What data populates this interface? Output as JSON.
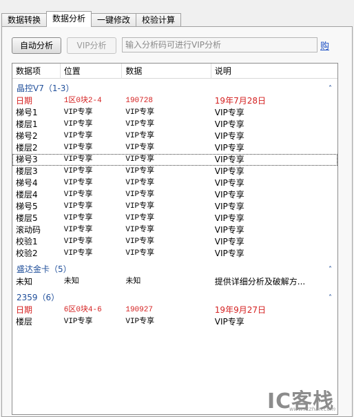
{
  "tabs": [
    "数据转换",
    "数据分析",
    "一键修改",
    "校验计算"
  ],
  "active_tab": 1,
  "toolbar": {
    "auto_analyze_label": "自动分析",
    "vip_analyze_label": "VIP分析",
    "code_placeholder": "输入分析码可进行VIP分析",
    "buy_label": "购"
  },
  "columns": [
    "数据项",
    "位置",
    "数据",
    "说明"
  ],
  "groups": [
    {
      "title": "晶控V7（1-3）",
      "rows": [
        {
          "item": "日期",
          "pos": "1区0块2-4",
          "data": "190728",
          "desc": "19年7月28日",
          "red": true
        },
        {
          "item": "梯号1",
          "pos": "VIP专享",
          "data": "VIP专享",
          "desc": "VIP专享"
        },
        {
          "item": "楼层1",
          "pos": "VIP专享",
          "data": "VIP专享",
          "desc": "VIP专享"
        },
        {
          "item": "梯号2",
          "pos": "VIP专享",
          "data": "VIP专享",
          "desc": "VIP专享"
        },
        {
          "item": "楼层2",
          "pos": "VIP专享",
          "data": "VIP专享",
          "desc": "VIP专享"
        },
        {
          "item": "梯号3",
          "pos": "VIP专享",
          "data": "VIP专享",
          "desc": "VIP专享",
          "focus": true
        },
        {
          "item": "楼层3",
          "pos": "VIP专享",
          "data": "VIP专享",
          "desc": "VIP专享"
        },
        {
          "item": "梯号4",
          "pos": "VIP专享",
          "data": "VIP专享",
          "desc": "VIP专享"
        },
        {
          "item": "楼层4",
          "pos": "VIP专享",
          "data": "VIP专享",
          "desc": "VIP专享"
        },
        {
          "item": "梯号5",
          "pos": "VIP专享",
          "data": "VIP专享",
          "desc": "VIP专享"
        },
        {
          "item": "楼层5",
          "pos": "VIP专享",
          "data": "VIP专享",
          "desc": "VIP专享"
        },
        {
          "item": "滚动码",
          "pos": "VIP专享",
          "data": "VIP专享",
          "desc": "VIP专享"
        },
        {
          "item": "校验1",
          "pos": "VIP专享",
          "data": "VIP专享",
          "desc": "VIP专享"
        },
        {
          "item": "校验2",
          "pos": "VIP专享",
          "data": "VIP专享",
          "desc": "VIP专享"
        }
      ]
    },
    {
      "title": "盛达金卡（5）",
      "rows": [
        {
          "item": "未知",
          "pos": "未知",
          "data": "未知",
          "desc": "提供详细分析及破解方..."
        }
      ]
    },
    {
      "title": "2359（6）",
      "rows": [
        {
          "item": "日期",
          "pos": "6区0块4-6",
          "data": "190927",
          "desc": "19年9月27日",
          "red": true
        },
        {
          "item": "楼层",
          "pos": "VIP专享",
          "data": "VIP专享",
          "desc": "VIP专享"
        }
      ]
    }
  ],
  "collapse_icon": "chevron-up-icon",
  "colors": {
    "red": "#d41f1f",
    "group_blue": "#1f4e9a",
    "link": "#1d4fc4"
  },
  "watermark": {
    "text": "IC客栈",
    "url": "www.iczhan.com"
  }
}
